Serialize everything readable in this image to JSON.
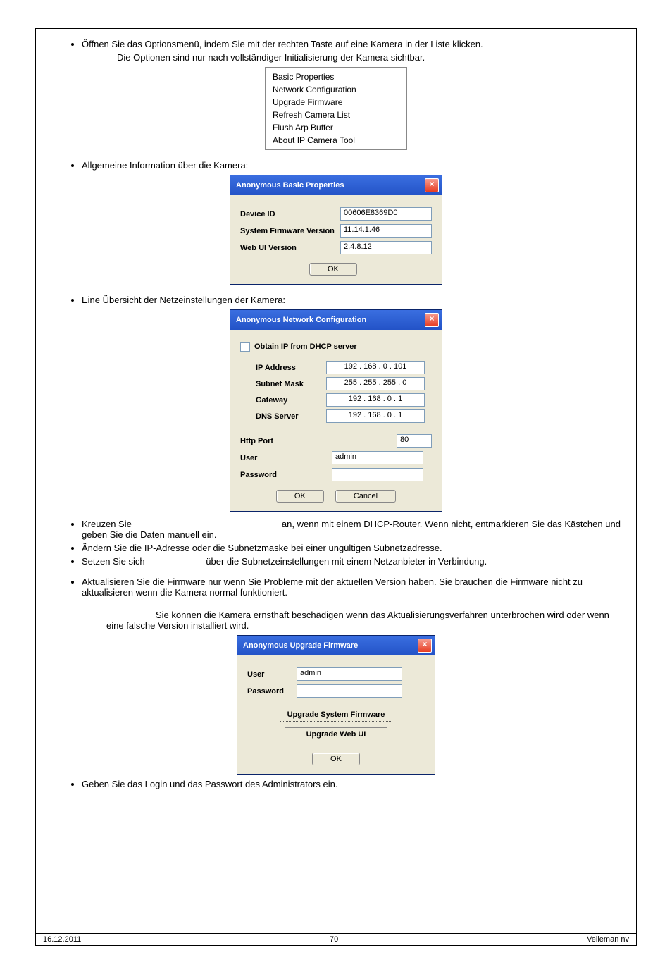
{
  "bullets": {
    "b1": "Öffnen Sie das Optionsmenü, indem Sie mit der rechten Taste auf eine Kamera in der Liste klicken.",
    "b1_sub": "Die Optionen sind nur nach vollständiger Initialisierung der Kamera sichtbar.",
    "b2": "Allgemeine Information über die Kamera:",
    "b3": "Eine Übersicht der Netzeinstellungen der Kamera:",
    "b4": "Kreuzen Sie                                                           an, wenn mit einem DHCP-Router. Wenn nicht, entmarkieren Sie das Kästchen und geben Sie die Daten manuell ein.",
    "b5": "Ändern Sie die IP-Adresse oder die Subnetzmaske bei einer ungültigen Subnetzadresse.",
    "b6": "Setzen Sie sich                        über die Subnetzeinstellungen mit einem Netzanbieter in Verbindung.",
    "b7": "Aktualisieren Sie die Firmware nur wenn Sie Probleme mit der aktuellen Version haben. Sie brauchen die Firmware nicht zu aktualisieren wenn die Kamera normal funktioniert.",
    "b7_sub": "Sie können die Kamera ernsthaft beschädigen wenn das Aktualisierungsverfahren unterbrochen wird oder wenn eine falsche Version installiert wird.",
    "b8": "Geben Sie das Login und das Passwort des Administrators ein."
  },
  "ctx_menu": {
    "items": [
      "Basic Properties",
      "Network Configuration",
      "Upgrade Firmware",
      "Refresh Camera List",
      "Flush Arp Buffer",
      "About IP Camera Tool"
    ]
  },
  "dlg_basic": {
    "title": "Anonymous Basic Properties",
    "device_id_lbl": "Device ID",
    "device_id": "00606E8369D0",
    "fw_lbl": "System Firmware Version",
    "fw": "11.14.1.46",
    "webui_lbl": "Web UI Version",
    "webui": "2.4.8.12",
    "ok": "OK"
  },
  "dlg_net": {
    "title": "Anonymous Network Configuration",
    "dhcp": "Obtain IP from DHCP server",
    "ip_lbl": "IP Address",
    "ip": "192 . 168 .  0  . 101",
    "mask_lbl": "Subnet Mask",
    "mask": "255 . 255 . 255 .  0",
    "gw_lbl": "Gateway",
    "gw": "192 . 168 .  0  .  1",
    "dns_lbl": "DNS Server",
    "dns": "192 . 168 .  0  .  1",
    "port_lbl": "Http Port",
    "port": "80",
    "user_lbl": "User",
    "user": "admin",
    "pw_lbl": "Password",
    "ok": "OK",
    "cancel": "Cancel"
  },
  "dlg_up": {
    "title": "Anonymous Upgrade Firmware",
    "user_lbl": "User",
    "user": "admin",
    "pw_lbl": "Password",
    "btn1": "Upgrade System Firmware",
    "btn2": "Upgrade Web UI",
    "ok": "OK"
  },
  "footer": {
    "left": "16.12.2011",
    "center": "70",
    "right": "Velleman nv"
  }
}
